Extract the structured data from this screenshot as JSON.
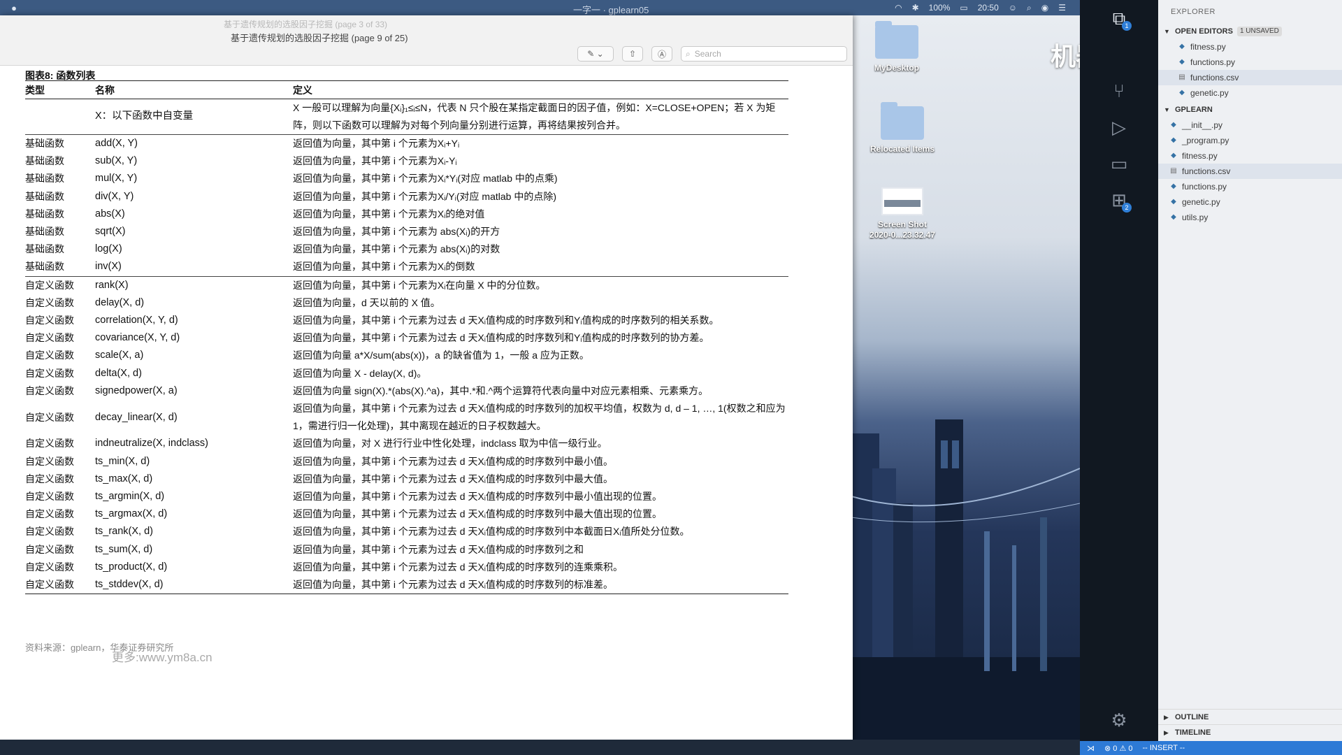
{
  "menubar": {
    "center_title": "一字一 · gplearn05",
    "battery": "100%",
    "clock": "20:50"
  },
  "viewer": {
    "ghost_title": "基于遗传规划的选股因子挖掘 (page 3 of 33)",
    "document_title": "基于遗传规划的选股因子挖掘  (page 9 of 25)",
    "search_placeholder": "Search"
  },
  "table": {
    "title": "图表8:  函数列表",
    "headers": [
      "类型",
      "名称",
      "定义"
    ],
    "rows": [
      {
        "type": "",
        "name": "X：以下函数中自变量",
        "def": "X 一般可以理解为向量{Xᵢ}₁≤ᵢ≤N，代表 N 只个股在某指定截面日的因子值，例如：X=CLOSE+OPEN；若 X 为矩阵，则以下函数可以理解为对每个列向量分别进行运算，再将结果按列合并。"
      },
      {
        "type": "基础函数",
        "name": "add(X, Y)",
        "def": "返回值为向量，其中第 i 个元素为Xᵢ+Yᵢ"
      },
      {
        "type": "基础函数",
        "name": "sub(X, Y)",
        "def": "返回值为向量，其中第 i 个元素为Xᵢ-Yᵢ"
      },
      {
        "type": "基础函数",
        "name": "mul(X, Y)",
        "def": "返回值为向量，其中第 i 个元素为Xᵢ*Yᵢ(对应 matlab 中的点乘)"
      },
      {
        "type": "基础函数",
        "name": "div(X, Y)",
        "def": "返回值为向量，其中第 i 个元素为Xᵢ/Yᵢ(对应 matlab 中的点除)"
      },
      {
        "type": "基础函数",
        "name": "abs(X)",
        "def": "返回值为向量，其中第 i 个元素为Xᵢ的绝对值"
      },
      {
        "type": "基础函数",
        "name": "sqrt(X)",
        "def": "返回值为向量，其中第 i 个元素为 abs(Xᵢ)的开方"
      },
      {
        "type": "基础函数",
        "name": "log(X)",
        "def": "返回值为向量，其中第 i 个元素为 abs(Xᵢ)的对数"
      },
      {
        "type": "基础函数",
        "name": "inv(X)",
        "def": "返回值为向量，其中第 i 个元素为Xᵢ的倒数"
      },
      {
        "type": "自定义函数",
        "name": "rank(X)",
        "def": "返回值为向量，其中第 i 个元素为Xᵢ在向量 X 中的分位数。"
      },
      {
        "type": "自定义函数",
        "name": "delay(X, d)",
        "def": "返回值为向量，d 天以前的 X 值。"
      },
      {
        "type": "自定义函数",
        "name": "correlation(X, Y, d)",
        "def": "返回值为向量，其中第 i 个元素为过去 d 天Xᵢ值构成的时序数列和Yᵢ值构成的时序数列的相关系数。"
      },
      {
        "type": "自定义函数",
        "name": "covariance(X, Y, d)",
        "def": "返回值为向量，其中第 i 个元素为过去 d 天Xᵢ值构成的时序数列和Yᵢ值构成的时序数列的协方差。"
      },
      {
        "type": "自定义函数",
        "name": "scale(X, a)",
        "def": "返回值为向量 a*X/sum(abs(x))，a 的缺省值为 1，一般 a 应为正数。"
      },
      {
        "type": "自定义函数",
        "name": "delta(X, d)",
        "def": "返回值为向量 X - delay(X, d)。"
      },
      {
        "type": "自定义函数",
        "name": "signedpower(X, a)",
        "def": "返回值为向量 sign(X).*(abs(X).^a)，其中.*和.^两个运算符代表向量中对应元素相乘、元素乘方。"
      },
      {
        "type": "自定义函数",
        "name": "decay_linear(X, d)",
        "def": "返回值为向量，其中第 i 个元素为过去 d 天Xᵢ值构成的时序数列的加权平均值，权数为 d, d – 1, …, 1(权数之和应为 1，需进行归一化处理)，其中离现在越近的日子权数越大。"
      },
      {
        "type": "自定义函数",
        "name": "indneutralize(X, indclass)",
        "def": "返回值为向量，对 X 进行行业中性化处理，indclass 取为中信一级行业。"
      },
      {
        "type": "自定义函数",
        "name": "ts_min(X, d)",
        "def": "返回值为向量，其中第 i 个元素为过去 d 天Xᵢ值构成的时序数列中最小值。"
      },
      {
        "type": "自定义函数",
        "name": "ts_max(X, d)",
        "def": "返回值为向量，其中第 i 个元素为过去 d 天Xᵢ值构成的时序数列中最大值。"
      },
      {
        "type": "自定义函数",
        "name": "ts_argmin(X, d)",
        "def": "返回值为向量，其中第 i 个元素为过去 d 天Xᵢ值构成的时序数列中最小值出现的位置。"
      },
      {
        "type": "自定义函数",
        "name": "ts_argmax(X, d)",
        "def": "返回值为向量，其中第 i 个元素为过去 d 天Xᵢ值构成的时序数列中最大值出现的位置。"
      },
      {
        "type": "自定义函数",
        "name": "ts_rank(X, d)",
        "def": "返回值为向量，其中第 i 个元素为过去 d 天Xᵢ值构成的时序数列中本截面日Xᵢ值所处分位数。"
      },
      {
        "type": "自定义函数",
        "name": "ts_sum(X, d)",
        "def": "返回值为向量，其中第 i 个元素为过去 d 天Xᵢ值构成的时序数列之和"
      },
      {
        "type": "自定义函数",
        "name": "ts_product(X, d)",
        "def": "返回值为向量，其中第 i 个元素为过去 d 天Xᵢ值构成的时序数列的连乘乘积。"
      },
      {
        "type": "自定义函数",
        "name": "ts_stddev(X, d)",
        "def": "返回值为向量，其中第 i 个元素为过去 d 天Xᵢ值构成的时序数列的标准差。"
      }
    ],
    "source": "资料来源：gplearn，华泰证券研究所",
    "source_ghost": "更多:www.ym8a.cn"
  },
  "desktop": {
    "items": [
      {
        "label": "MyDesktop"
      },
      {
        "label": "Relocated Items"
      },
      {
        "label": "Screen Shot\n2020-0...23.32.47"
      }
    ],
    "watermark": "机器学习"
  },
  "vscode": {
    "explorer_header": "EXPLORER",
    "open_editors_label": "OPEN EDITORS",
    "open_editors_badge": "1 UNSAVED",
    "open_editors": [
      {
        "name": "fitness.py",
        "type": "py"
      },
      {
        "name": "functions.py",
        "type": "py"
      },
      {
        "name": "functions.csv",
        "type": "csv"
      },
      {
        "name": "genetic.py",
        "type": "py"
      }
    ],
    "project_label": "GPLEARN",
    "project_files": [
      {
        "name": "__init__.py",
        "type": "py"
      },
      {
        "name": "_program.py",
        "type": "py"
      },
      {
        "name": "fitness.py",
        "type": "py"
      },
      {
        "name": "functions.csv",
        "type": "csv"
      },
      {
        "name": "functions.py",
        "type": "py"
      },
      {
        "name": "genetic.py",
        "type": "py"
      },
      {
        "name": "utils.py",
        "type": "py"
      }
    ],
    "outline_label": "OUTLINE",
    "timeline_label": "TIMELINE",
    "status": {
      "errors": "⊗ 0 ⚠ 0",
      "mode": "-- INSERT --"
    },
    "explorer_badge": "1",
    "extensions_badge": "2"
  }
}
